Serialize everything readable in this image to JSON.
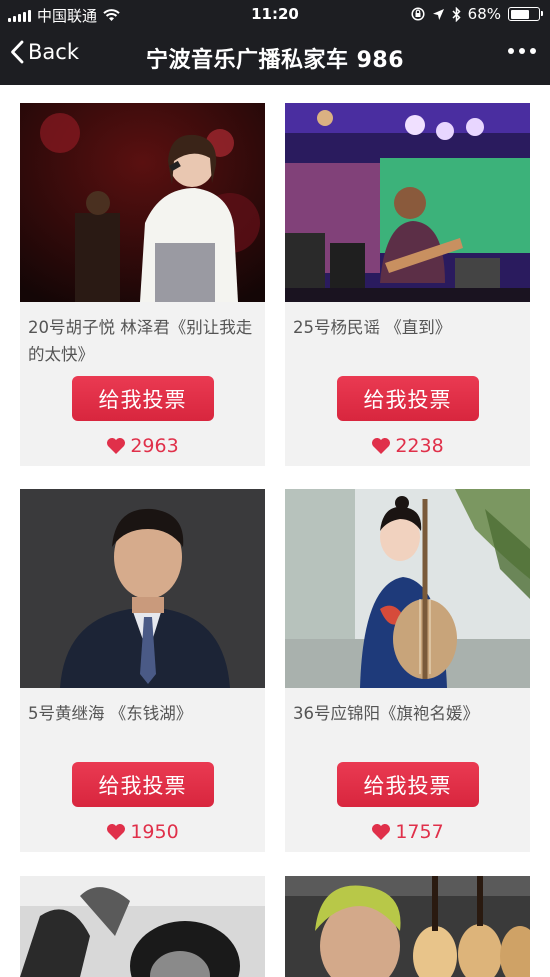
{
  "status_bar": {
    "carrier": "中国联通",
    "time": "11:20",
    "battery": "68%",
    "battery_level": 0.68
  },
  "nav": {
    "back_label": "Back",
    "title": "宁波音乐广播私家车 986"
  },
  "vote_label": "给我投票",
  "cards": [
    {
      "caption": "20号胡子悦 林泽君《别让我走的太快》",
      "likes": "2963",
      "photo_icon": "singer-photo"
    },
    {
      "caption": "25号杨民谣 《直到》",
      "likes": "2238",
      "photo_icon": "stage-photo"
    },
    {
      "caption": "5号黄继海 《东钱湖》",
      "likes": "1950",
      "photo_icon": "portrait-photo"
    },
    {
      "caption": "36号应锦阳《旗袍名媛》",
      "likes": "1757",
      "photo_icon": "pipa-player-photo"
    },
    {
      "photo_icon": "bw-portrait-photo"
    },
    {
      "photo_icon": "guitar-shop-photo"
    }
  ],
  "colors": {
    "bar_bg": "#1d1e22",
    "accent": "#e0304a",
    "card_bg": "#f2f2f2"
  }
}
